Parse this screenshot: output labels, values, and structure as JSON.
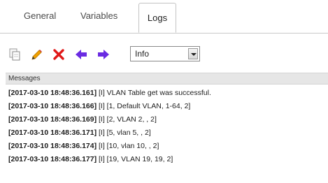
{
  "tabs": {
    "general": "General",
    "variables": "Variables",
    "logs": "Logs"
  },
  "toolbar": {
    "icons": [
      "copy-icon",
      "pencil-icon",
      "delete-x-icon",
      "arrow-left-icon",
      "arrow-right-icon"
    ],
    "level_select": {
      "value": "Info"
    }
  },
  "colors": {
    "delete": "#e01818",
    "arrows": "#6a2be2",
    "pencil": "#f0a000"
  },
  "messages": {
    "header": "Messages",
    "rows": [
      {
        "timestamp": "[2017-03-10 18:48:36.161]",
        "text": " [I] VLAN Table get was successful."
      },
      {
        "timestamp": "[2017-03-10 18:48:36.166]",
        "text": " [I] [1, Default VLAN, 1-64, 2]"
      },
      {
        "timestamp": "[2017-03-10 18:48:36.169]",
        "text": " [I] [2, VLAN 2, , 2]"
      },
      {
        "timestamp": "[2017-03-10 18:48:36.171]",
        "text": " [I] [5, vlan 5, , 2]"
      },
      {
        "timestamp": "[2017-03-10 18:48:36.174]",
        "text": " [I] [10, vlan 10, , 2]"
      },
      {
        "timestamp": "[2017-03-10 18:48:36.177]",
        "text": " [I] [19, VLAN 19, 19, 2]"
      }
    ]
  }
}
